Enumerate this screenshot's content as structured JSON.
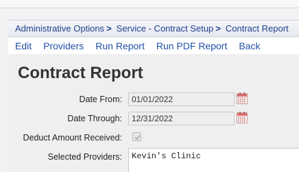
{
  "breadcrumb": {
    "items": [
      "Administrative Options",
      "Service - Contract Setup",
      "Contract Report"
    ],
    "separator": ">"
  },
  "menu": {
    "items": [
      "Edit",
      "Providers",
      "Run Report",
      "Run PDF Report",
      "Back"
    ]
  },
  "page": {
    "title": "Contract Report"
  },
  "form": {
    "date_from_label": "Date From:",
    "date_from_value": "01/01/2022",
    "date_through_label": "Date Through:",
    "date_through_value": "12/31/2022",
    "deduct_label": "Deduct Amount Received:",
    "deduct_checked": true,
    "deduct_disabled": true,
    "providers_label": "Selected Providers:",
    "providers_value": "Kevin's Clinic"
  },
  "icons": {
    "calendar": "calendar-icon",
    "checkmark": "checkmark-icon"
  },
  "colors": {
    "link": "#2050a6",
    "breadcrumb": "#1f3f8f",
    "title": "#333333",
    "calendar_accent": "#e07070"
  }
}
